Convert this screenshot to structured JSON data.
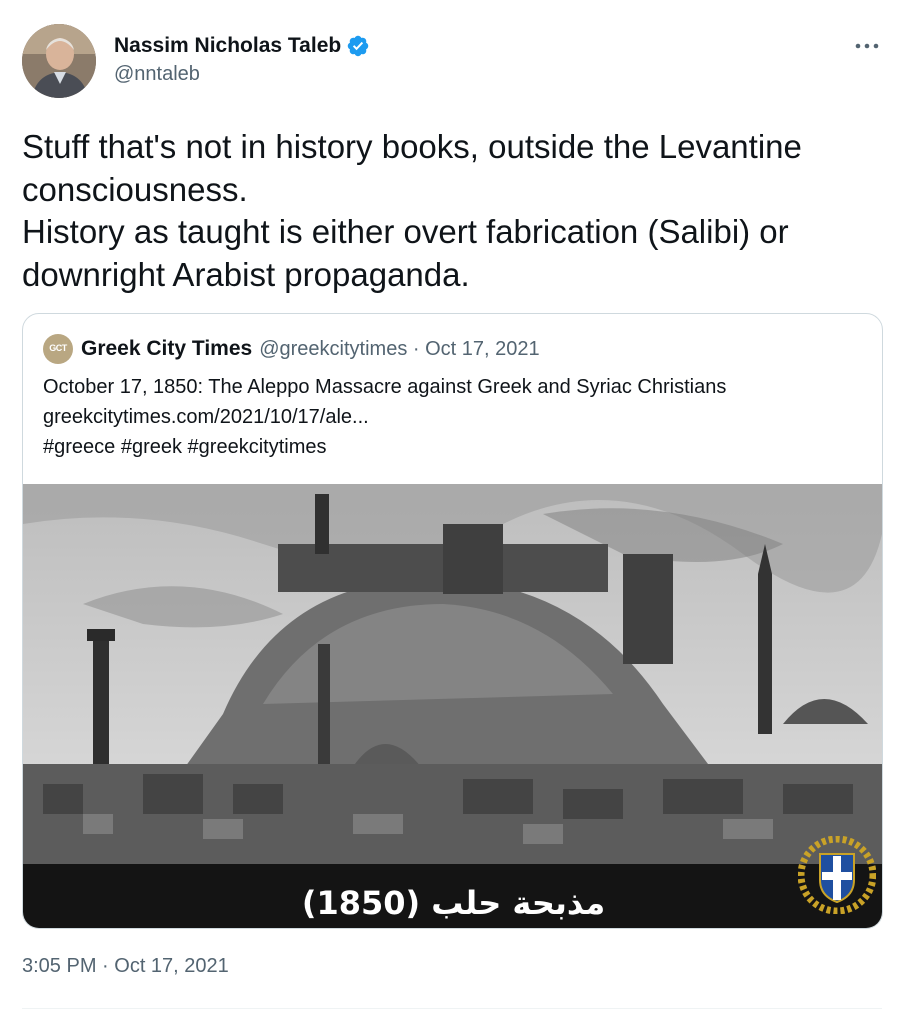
{
  "author": {
    "display_name": "Nassim Nicholas Taleb",
    "handle": "@nntaleb",
    "verified": true,
    "verified_color": "#1d9bf0"
  },
  "tweet": {
    "lines": [
      "Stuff that's not in history books, outside the Levantine",
      "consciousness.",
      "History as taught is either overt fabrication (Salibi) or",
      "downright Arabist propaganda."
    ]
  },
  "quote": {
    "display_name": "Greek City Times",
    "avatar_text": "GCT",
    "meta": "@greekcitytimes · Oct 17, 2021",
    "lines": [
      "October 17, 1850: The Aleppo Massacre against Greek and Syriac Christians",
      "greekcitytimes.com/2021/10/17/ale...",
      "#greece #greek #greekcitytimes"
    ],
    "image_caption": "(1850) مذبحة حلب"
  },
  "timestamp": "3:05 PM · Oct 17, 2021",
  "colors": {
    "text_primary": "#0f1419",
    "text_secondary": "#536471",
    "border": "#cfd9de"
  }
}
